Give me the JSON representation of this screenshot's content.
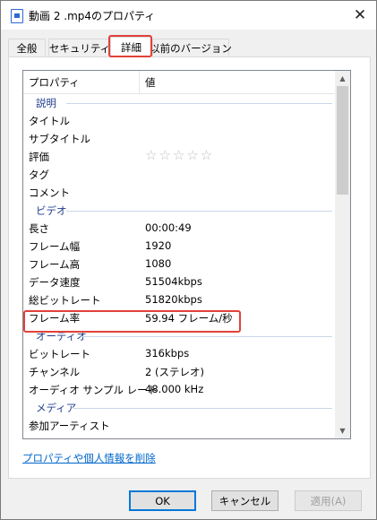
{
  "window": {
    "title": "動画 2 .mp4のプロパティ"
  },
  "tabs": [
    {
      "label": "全般"
    },
    {
      "label": "セキュリティ"
    },
    {
      "label": "詳細"
    },
    {
      "label": "以前のバージョン"
    }
  ],
  "list": {
    "headers": {
      "property": "プロパティ",
      "value": "値"
    },
    "groups": {
      "description": "説明",
      "video": "ビデオ",
      "audio": "オーディオ",
      "media": "メディア"
    },
    "description_rows": [
      {
        "key": "タイトル",
        "value": ""
      },
      {
        "key": "サブタイトル",
        "value": ""
      },
      {
        "key": "評価",
        "value": ""
      },
      {
        "key": "タグ",
        "value": ""
      },
      {
        "key": "コメント",
        "value": ""
      }
    ],
    "rating": {
      "stars": "☆☆☆☆☆",
      "value": 0,
      "max": 5
    },
    "video_rows": [
      {
        "key": "長さ",
        "value": "00:00:49"
      },
      {
        "key": "フレーム幅",
        "value": "1920"
      },
      {
        "key": "フレーム高",
        "value": "1080"
      },
      {
        "key": "データ速度",
        "value": "51504kbps"
      },
      {
        "key": "総ビットレート",
        "value": "51820kbps"
      },
      {
        "key": "フレーム率",
        "value": "59.94 フレーム/秒"
      }
    ],
    "audio_rows": [
      {
        "key": "ビットレート",
        "value": "316kbps"
      },
      {
        "key": "チャンネル",
        "value": "2 (ステレオ)"
      },
      {
        "key": "オーディオ サンプル レート",
        "value": "48.000 kHz"
      }
    ],
    "media_rows": [
      {
        "key": "参加アーティスト",
        "value": ""
      }
    ]
  },
  "link": {
    "label": "プロパティや個人情報を削除"
  },
  "buttons": {
    "ok": "OK",
    "cancel": "キャンセル",
    "apply": "適用(A)"
  }
}
